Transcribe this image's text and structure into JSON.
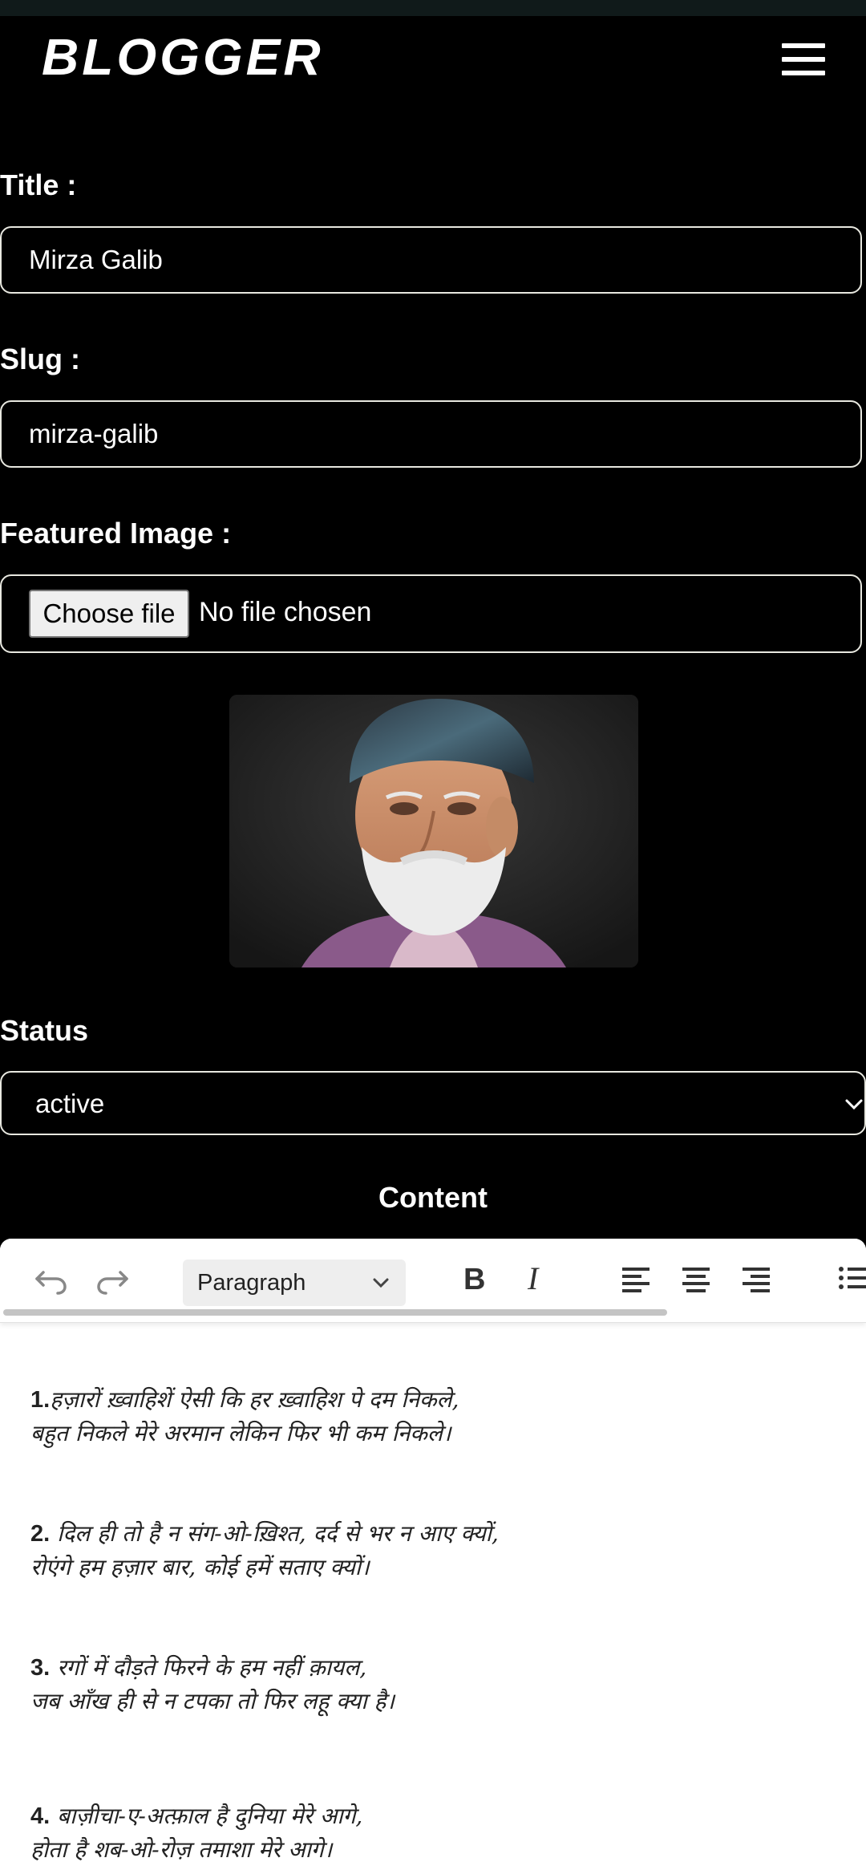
{
  "app": {
    "brand": "BLOGGER"
  },
  "form": {
    "title_label": "Title :",
    "title_value": "Mirza Galib",
    "slug_label": "Slug :",
    "slug_value": "mirza-galib",
    "featured_image_label": "Featured Image :",
    "file_button_label": "Choose file",
    "file_status": "No file chosen",
    "status_label": "Status",
    "status_value": "active"
  },
  "editor": {
    "heading": "Content",
    "block_format": "Paragraph",
    "toolbar_icons": [
      "undo-icon",
      "redo-icon",
      "bold-icon",
      "italic-icon",
      "align-left-icon",
      "align-center-icon",
      "align-right-icon",
      "bulleted-list-icon"
    ],
    "verses": [
      {
        "num": "1.",
        "line1": "हज़ारों ख़्वाहिशें ऐसी कि हर ख़्वाहिश पे दम निकले,",
        "line2": "बहुत निकले मेरे अरमान लेकिन फिर भी कम निकले।"
      },
      {
        "num": "2.",
        "line1": "दिल ही तो है न संग-ओ-ख़िश्त, दर्द से भर न आए क्यों,",
        "line2": "रोएंगे हम हज़ार बार, कोई हमें सताए क्यों।"
      },
      {
        "num": "3.",
        "line1": "रगों में दौड़ते फिरने के हम नहीं क़ायल,",
        "line2": "जब आँख ही से न टपका तो फिर लहू क्या है।"
      },
      {
        "num": "4.",
        "line1": "बाज़ीचा-ए-अत्फ़ाल है दुनिया मेरे आगे,",
        "line2": "होता है शब-ओ-रोज़ तमाशा मेरे आगे।"
      }
    ]
  },
  "icons": {
    "menu": "hamburger-menu-icon",
    "select_chevron": "chevron-down-icon"
  }
}
